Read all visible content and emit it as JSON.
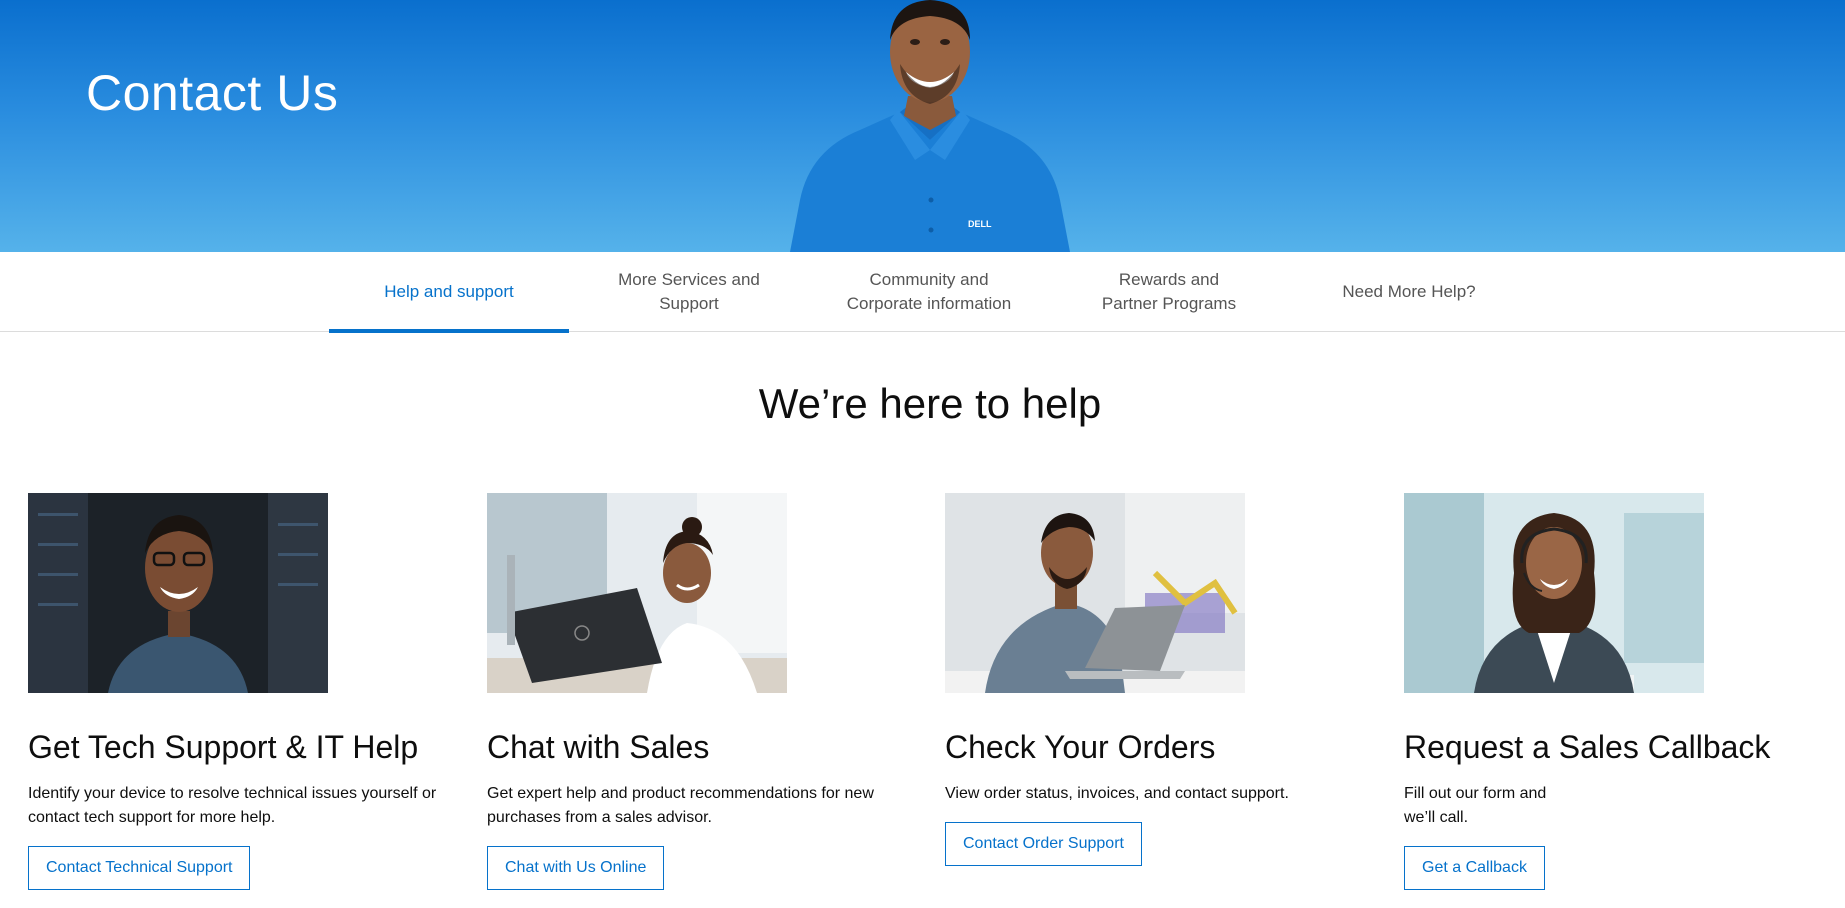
{
  "hero": {
    "title": "Contact Us",
    "shirt_logo": "DELL"
  },
  "tabs": [
    {
      "label": "Help and support",
      "active": true
    },
    {
      "label": "More Services and Support",
      "active": false
    },
    {
      "label": "Community and Corporate information",
      "active": false
    },
    {
      "label": "Rewards and Partner Programs",
      "active": false
    },
    {
      "label": "Need More Help?",
      "active": false
    }
  ],
  "section": {
    "title": "We’re here to help"
  },
  "cards": [
    {
      "title": "Get Tech Support & IT Help",
      "description": "Identify your device to resolve technical issues yourself or contact tech support for more help.",
      "button": "Contact Technical Support"
    },
    {
      "title": "Chat with Sales",
      "description": "Get expert help and product recommendations for new purchases from a sales advisor.",
      "button": "Chat with Us Online"
    },
    {
      "title": "Check Your Orders",
      "description": "View order status, invoices, and contact support.",
      "button": "Contact Order Support"
    },
    {
      "title": "Request a Sales Callback",
      "description": "Fill out our form and we’ll call.",
      "button": "Get a Callback"
    }
  ],
  "colors": {
    "accent": "#0672cb",
    "hero_top": "#0a6fce",
    "hero_bottom": "#55b2ea",
    "text": "#0e0e0e"
  }
}
